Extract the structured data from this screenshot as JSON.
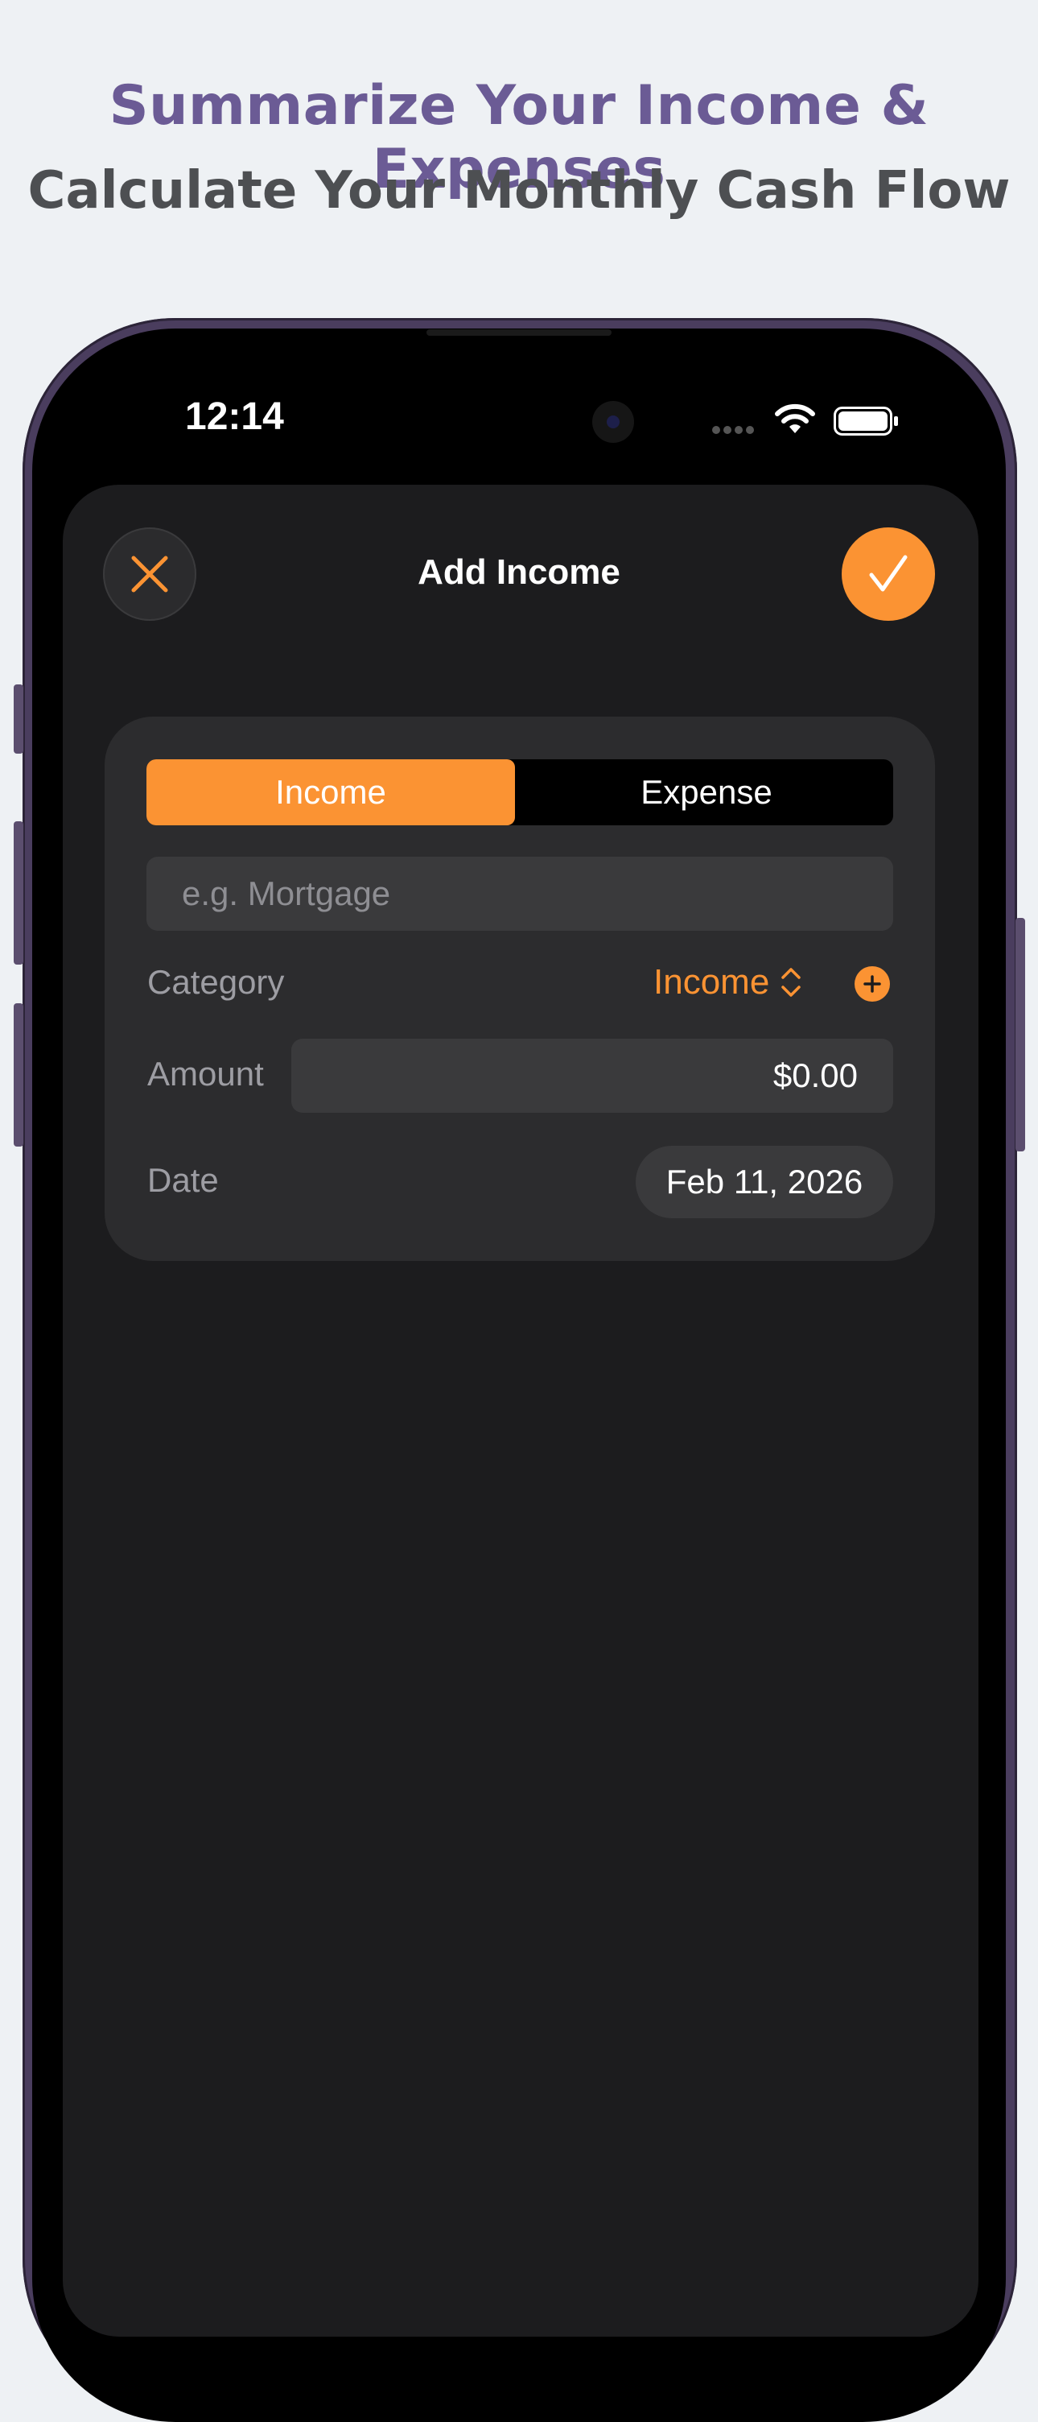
{
  "marketing": {
    "headline": "Summarize Your Income & Expenses",
    "subheadline": "Calculate Your Monthly Cash Flow"
  },
  "status_bar": {
    "time": "12:14",
    "icons": [
      "cellular-signal-icon",
      "wifi-icon",
      "battery-icon"
    ]
  },
  "sheet": {
    "title": "Add Income",
    "close_icon": "close-icon",
    "confirm_icon": "checkmark-icon"
  },
  "form": {
    "type_segments": [
      {
        "label": "Income",
        "selected": true
      },
      {
        "label": "Expense",
        "selected": false
      }
    ],
    "name_field": {
      "value": "",
      "placeholder": "e.g. Mortgage"
    },
    "category": {
      "label": "Category",
      "value": "Income",
      "icon": "chevron-up-down-icon",
      "add_icon": "plus-circle-icon"
    },
    "amount": {
      "label": "Amount",
      "value": "$0.00"
    },
    "date": {
      "label": "Date",
      "value": "Feb 11, 2026"
    }
  },
  "colors": {
    "accent": "#fb9333",
    "headline": "#6b5b95",
    "subheadline": "#4d4f52",
    "sheet_background": "#1c1c1e",
    "card_background": "#2c2c2e",
    "field_background": "#3a3a3c",
    "page_background": "#eef1f4"
  }
}
